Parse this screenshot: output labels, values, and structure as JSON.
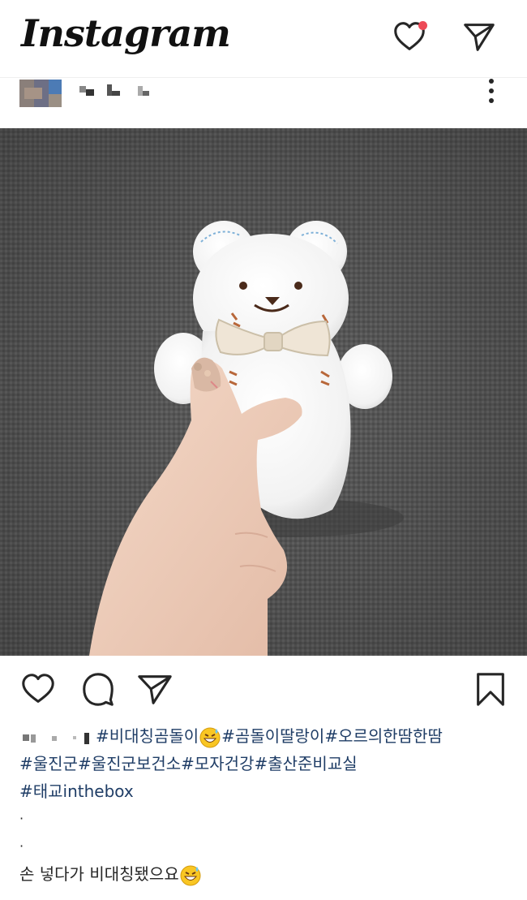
{
  "header": {
    "logo": "Instagram",
    "icons": [
      "heart-icon",
      "send-icon"
    ],
    "notification_dot_color": "#ed4956"
  },
  "post": {
    "more_icon": "more-vertical-icon",
    "photo_alt": "white teddy bear doll with bow tie held by hand",
    "actions": {
      "icons": [
        "heart-icon",
        "comment-icon",
        "send-icon",
        "bookmark-icon"
      ]
    },
    "caption": {
      "line1_tags": [
        "#비대칭곰돌이",
        "#곰돌이딸랑이#오르의한땀한땀"
      ],
      "line2": "#울진군#울진군보건소#모자건강#출산준비교실",
      "line3": "#태교inthebox",
      "dot1": "·",
      "dot2": "·",
      "line_final": "손 넣다가 비대칭됐으요"
    }
  },
  "colors": {
    "hashtag": "#1f3d66",
    "text": "#262626"
  }
}
